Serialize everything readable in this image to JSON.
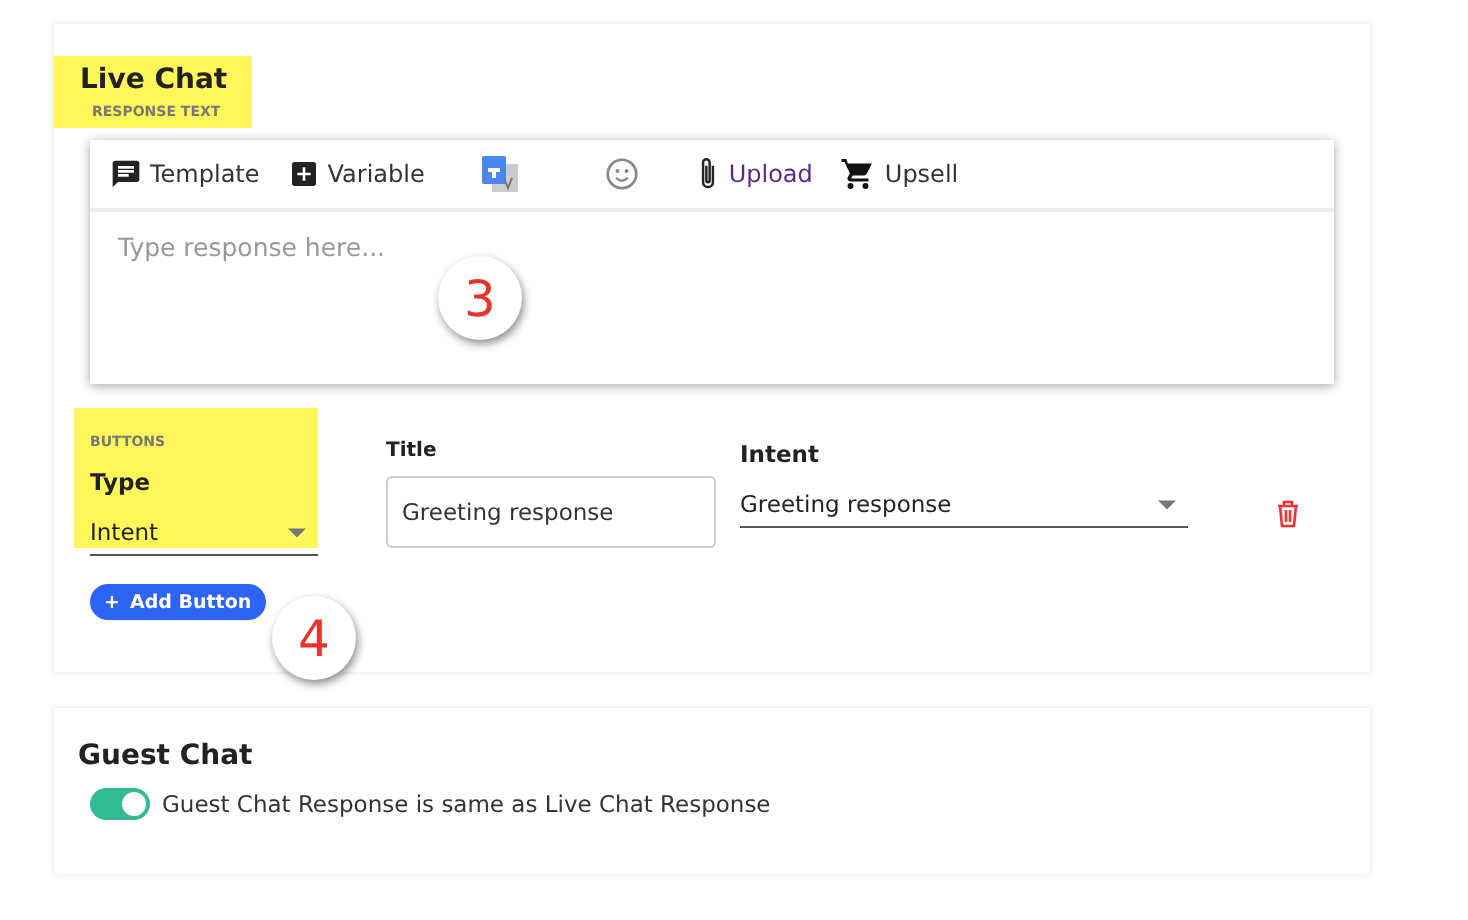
{
  "live_chat": {
    "title": "Live Chat",
    "subtitle": "RESPONSE TEXT",
    "highlighted": true,
    "toolbar": [
      {
        "kind": "template",
        "label": "Template"
      },
      {
        "kind": "variable",
        "label": "Variable"
      },
      {
        "kind": "translate"
      },
      {
        "kind": "emoji"
      },
      {
        "kind": "upload",
        "label": "Upload"
      },
      {
        "kind": "upsell",
        "label": "Upsell"
      }
    ],
    "editor": {
      "placeholder": "Type response here..."
    },
    "callout_editor": "3",
    "buttons_section": {
      "label": "BUTTONS",
      "highlighted": true,
      "type": {
        "label": "Type",
        "value": "Intent"
      },
      "title": {
        "label": "Title",
        "value": "Greeting response"
      },
      "intent": {
        "label": "Intent",
        "value": "Greeting response"
      }
    },
    "add_button": "Add Button",
    "add_icon": "+",
    "callout_add": "4"
  },
  "guest_chat": {
    "title": "Guest Chat",
    "toggle": {
      "on": true,
      "label": "Guest Chat Response is same as Live Chat Response"
    }
  }
}
